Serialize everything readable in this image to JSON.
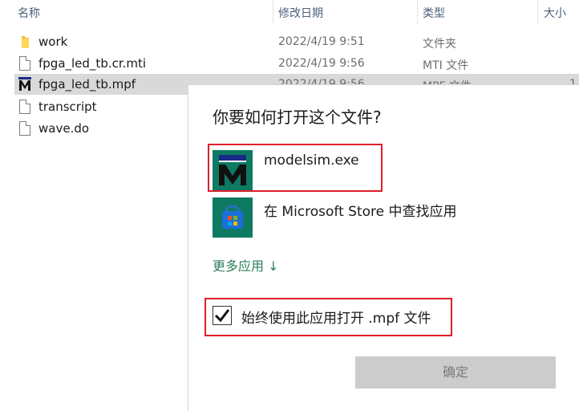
{
  "explorer": {
    "columns": {
      "name": "名称",
      "date": "修改日期",
      "type": "类型",
      "size": "大小"
    },
    "files": [
      {
        "name": "work",
        "date": "2022/4/19 9:51",
        "type": "文件夹",
        "size": "",
        "icon": "folder-icon"
      },
      {
        "name": "fpga_led_tb.cr.mti",
        "date": "2022/4/19 9:56",
        "type": "MTI 文件",
        "size": "",
        "icon": "file-icon"
      },
      {
        "name": "fpga_led_tb.mpf",
        "date": "2022/4/19 9:56",
        "type": "MPF 文件",
        "size": "1",
        "icon": "modelsim-file-icon"
      },
      {
        "name": "transcript",
        "date": "",
        "type": "",
        "size": "",
        "icon": "file-icon"
      },
      {
        "name": "wave.do",
        "date": "",
        "type": "",
        "size": "",
        "icon": "file-icon"
      }
    ]
  },
  "dialog": {
    "title": "你要如何打开这个文件?",
    "apps": [
      {
        "name": "modelsim.exe",
        "icon": "modelsim-icon"
      },
      {
        "name": "在 Microsoft Store 中查找应用",
        "icon": "microsoft-store-icon"
      }
    ],
    "more_apps": "更多应用 ↓",
    "always_use_label": "始终使用此应用打开 .mpf 文件",
    "always_use_checked": true,
    "ok_label": "确定"
  },
  "colors": {
    "accent": "#2e7d5b",
    "modelsim_bg": "#0f7a62",
    "highlight": "#e0202b",
    "selected_row": "#d9d9d9"
  }
}
